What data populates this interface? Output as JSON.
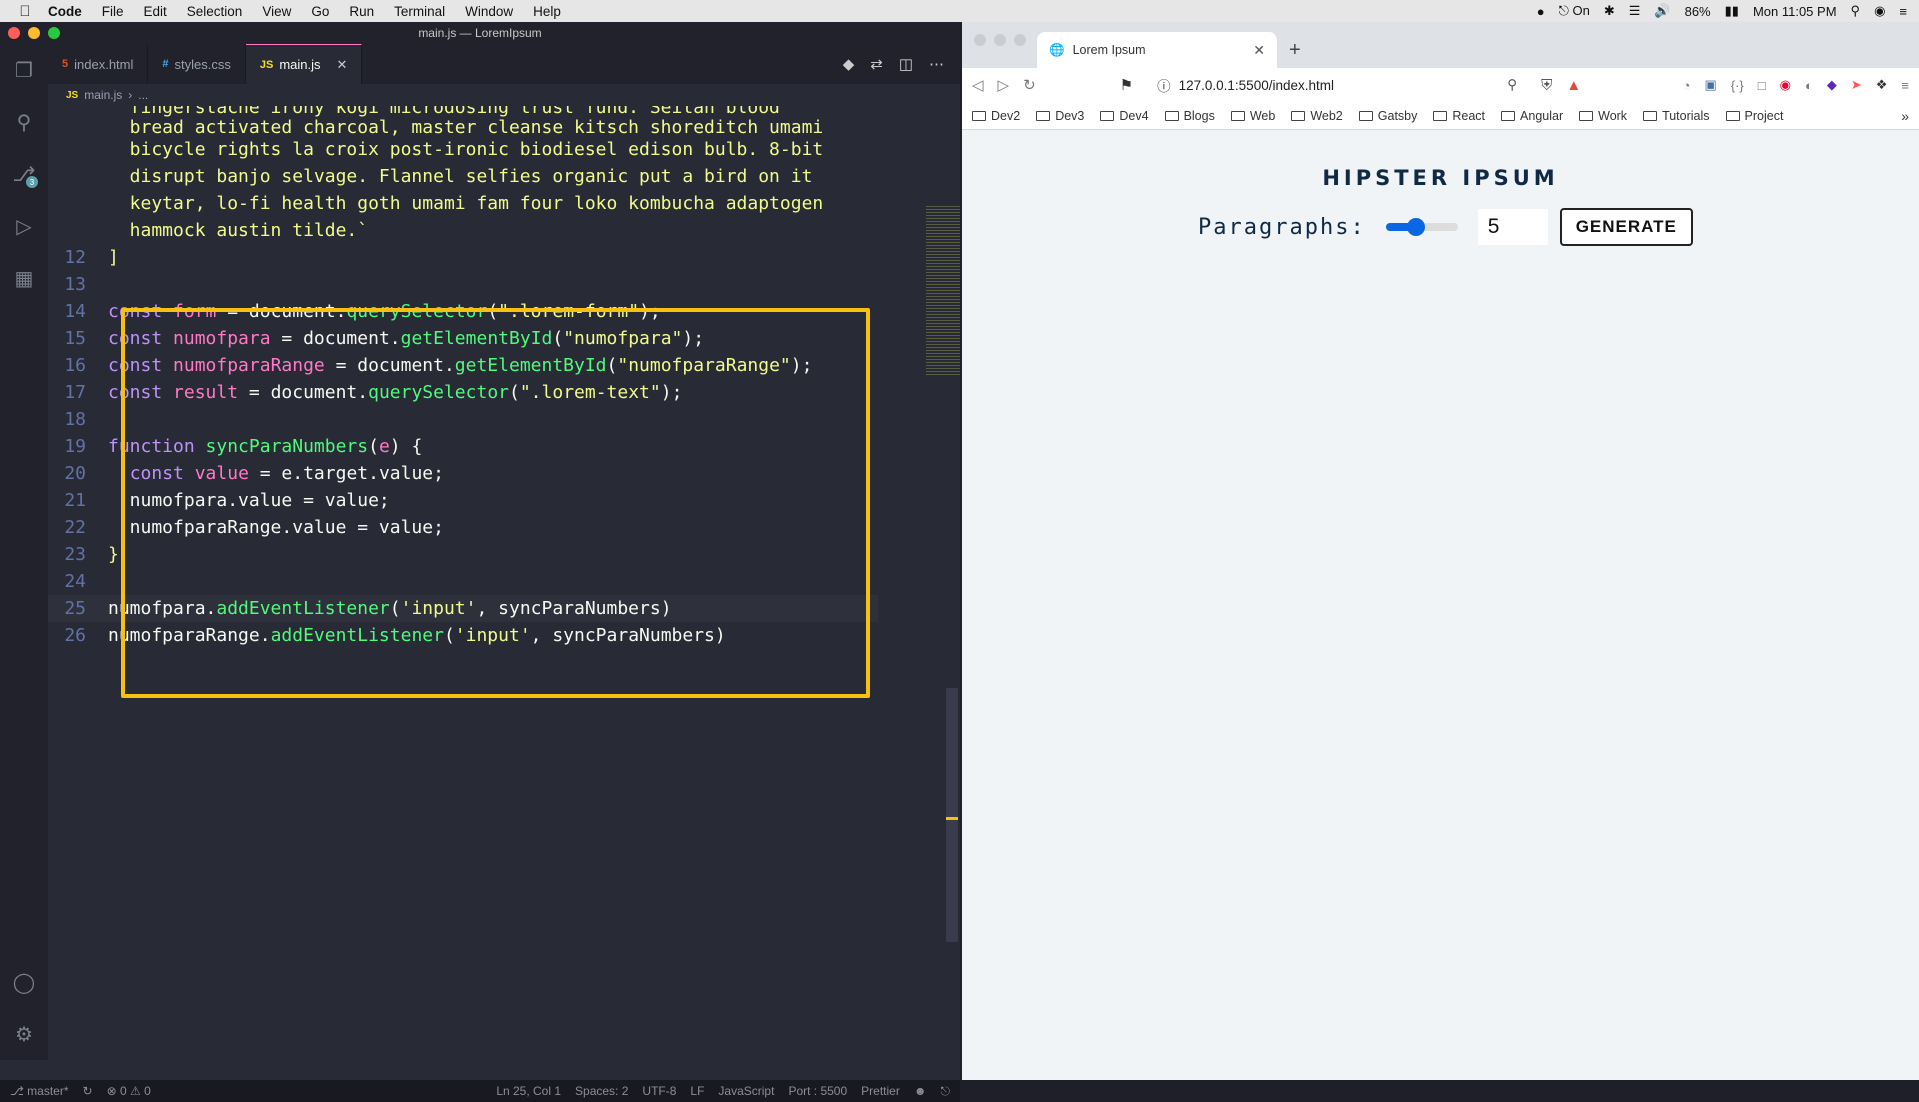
{
  "menubar": {
    "app": "Code",
    "items": [
      "File",
      "Edit",
      "Selection",
      "View",
      "Go",
      "Run",
      "Terminal",
      "Window",
      "Help"
    ],
    "right": {
      "focus": "On",
      "battery": "86%",
      "clock": "Mon 11:05 PM"
    }
  },
  "vscode": {
    "window_title": "main.js — LoremIpsum",
    "tabs": [
      {
        "label": "index.html",
        "icon": "html-icon"
      },
      {
        "label": "styles.css",
        "icon": "css-icon"
      },
      {
        "label": "main.js",
        "icon": "js-icon"
      }
    ],
    "breadcrumb": {
      "file": "main.js",
      "rest": "..."
    },
    "source_control_badge": "3",
    "statusbar": {
      "branch": "master*",
      "problems": "0",
      "warnings": "0",
      "position": "Ln 25, Col 1",
      "spaces": "Spaces: 2",
      "encoding": "UTF-8",
      "eol": "LF",
      "language": "JavaScript",
      "port": "Port : 5500",
      "formatter": "Prettier"
    },
    "lines": [
      {
        "num": "",
        "text": "  fingerstache irony kogi microdosing trust fund. Seitan blood"
      },
      {
        "num": "",
        "text": "  bread activated charcoal, master cleanse kitsch shoreditch umami"
      },
      {
        "num": "",
        "text": "  bicycle rights la croix post-ironic biodiesel edison bulb. 8-bit"
      },
      {
        "num": "",
        "text": "  disrupt banjo selvage. Flannel selfies organic put a bird on it"
      },
      {
        "num": "",
        "text": "  keytar, lo-fi health goth umami fam four loko kombucha adaptogen"
      },
      {
        "num": "",
        "text": "  hammock austin tilde.`"
      },
      {
        "num": "12",
        "text": "]"
      },
      {
        "num": "13",
        "text": ""
      },
      {
        "num": "14",
        "text": "const form = document.querySelector(\".lorem-form\");"
      },
      {
        "num": "15",
        "text": "const numofpara = document.getElementById(\"numofpara\");"
      },
      {
        "num": "16",
        "text": "const numofparaRange = document.getElementById(\"numofparaRange\");"
      },
      {
        "num": "17",
        "text": "const result = document.querySelector(\".lorem-text\");"
      },
      {
        "num": "18",
        "text": ""
      },
      {
        "num": "19",
        "text": "function syncParaNumbers(e) {"
      },
      {
        "num": "20",
        "text": "  const value = e.target.value;"
      },
      {
        "num": "21",
        "text": "  numofpara.value = value;"
      },
      {
        "num": "22",
        "text": "  numofparaRange.value = value;"
      },
      {
        "num": "23",
        "text": "}"
      },
      {
        "num": "24",
        "text": ""
      },
      {
        "num": "25",
        "text": "numofpara.addEventListener('input', syncParaNumbers)"
      },
      {
        "num": "26",
        "text": "numofparaRange.addEventListener('input', syncParaNumbers)"
      }
    ]
  },
  "browser": {
    "tab_title": "Lorem Ipsum",
    "url": "127.0.0.1:5500/index.html",
    "bookmarks": [
      "Dev2",
      "Dev3",
      "Dev4",
      "Blogs",
      "Web",
      "Web2",
      "Gatsby",
      "React",
      "Angular",
      "Work",
      "Tutorials",
      "Project"
    ],
    "page": {
      "title": "HIPSTER IPSUM",
      "label": "Paragraphs:",
      "range_value": 5,
      "input_value": "5",
      "button": "GENERATE"
    }
  },
  "colors": {
    "highlight_box": "#f7c113",
    "editor_bg": "#282a36",
    "page_bg": "#f0f4f7",
    "title_color": "#102a43",
    "slider_accent": "#0b66e4"
  }
}
